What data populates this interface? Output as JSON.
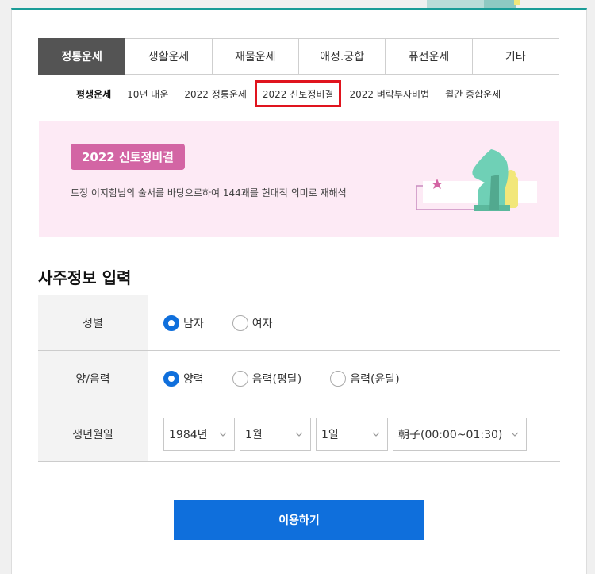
{
  "main_tabs": [
    {
      "label": "정통운세",
      "active": true
    },
    {
      "label": "생활운세",
      "active": false
    },
    {
      "label": "재물운세",
      "active": false
    },
    {
      "label": "애정.궁합",
      "active": false
    },
    {
      "label": "퓨전운세",
      "active": false
    },
    {
      "label": "기타",
      "active": false
    }
  ],
  "sub_tabs": [
    {
      "label": "평생운세"
    },
    {
      "label": "10년 대운"
    },
    {
      "label": "2022 정통운세"
    },
    {
      "label": "2022 신토정비결"
    },
    {
      "label": "2022 벼락부자비법"
    },
    {
      "label": "월간 종합운세"
    }
  ],
  "banner": {
    "badge": "2022 신토정비결",
    "description": "토정 이지함님의 술서를 바탕으로하여 144괘를 현대적 의미로 재해석"
  },
  "section": {
    "title": "사주정보 입력"
  },
  "form": {
    "gender": {
      "label": "성별",
      "options": [
        "남자",
        "여자"
      ],
      "selected": "남자"
    },
    "calendar": {
      "label": "양/음력",
      "options": [
        "양력",
        "음력(평달)",
        "음력(윤달)"
      ],
      "selected": "양력"
    },
    "birth": {
      "label": "생년월일",
      "year": "1984년",
      "month": "1월",
      "day": "1일",
      "hour": "朝子(00:00~01:30)"
    }
  },
  "submit_label": "이용하기",
  "colors": {
    "accent_teal": "#1a9c97",
    "active_tab": "#545454",
    "highlight_red": "#e0141e",
    "badge_pink": "#d365a4",
    "banner_bg": "#fdeaf5",
    "primary_blue": "#0f6fdc"
  }
}
